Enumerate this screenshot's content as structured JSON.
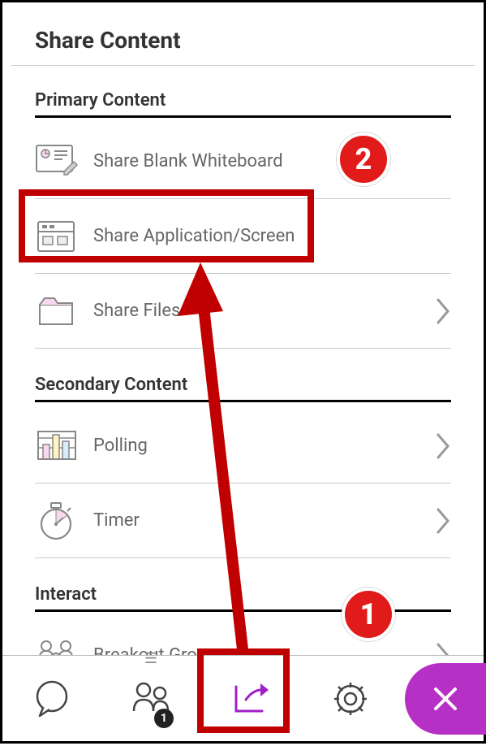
{
  "panel": {
    "title": "Share Content",
    "sections": [
      {
        "heading": "Primary Content",
        "items": [
          {
            "label": "Share Blank Whiteboard",
            "icon": "whiteboard-icon",
            "chevron": false
          },
          {
            "label": "Share Application/Screen",
            "icon": "screen-icon",
            "chevron": false
          },
          {
            "label": "Share Files",
            "icon": "folder-icon",
            "chevron": true
          }
        ]
      },
      {
        "heading": "Secondary Content",
        "items": [
          {
            "label": "Polling",
            "icon": "polling-icon",
            "chevron": true
          },
          {
            "label": "Timer",
            "icon": "stopwatch-icon",
            "chevron": true
          }
        ]
      },
      {
        "heading": "Interact",
        "items": [
          {
            "label": "Breakout Groups",
            "icon": "breakout-icon",
            "chevron": true
          }
        ]
      }
    ]
  },
  "bottombar": {
    "tabs": [
      {
        "name": "chat",
        "icon": "chat-icon"
      },
      {
        "name": "attendees",
        "icon": "attendees-icon",
        "badge": "1"
      },
      {
        "name": "share",
        "icon": "share-tab-icon",
        "active": true
      },
      {
        "name": "settings",
        "icon": "gear-icon"
      }
    ],
    "close": {
      "icon": "close-icon"
    }
  },
  "annotations": {
    "badge1": "1",
    "badge2": "2",
    "colors": {
      "badge_bg": "#e11a1a",
      "box_border": "#c00000",
      "accent": "#b730c5"
    }
  }
}
